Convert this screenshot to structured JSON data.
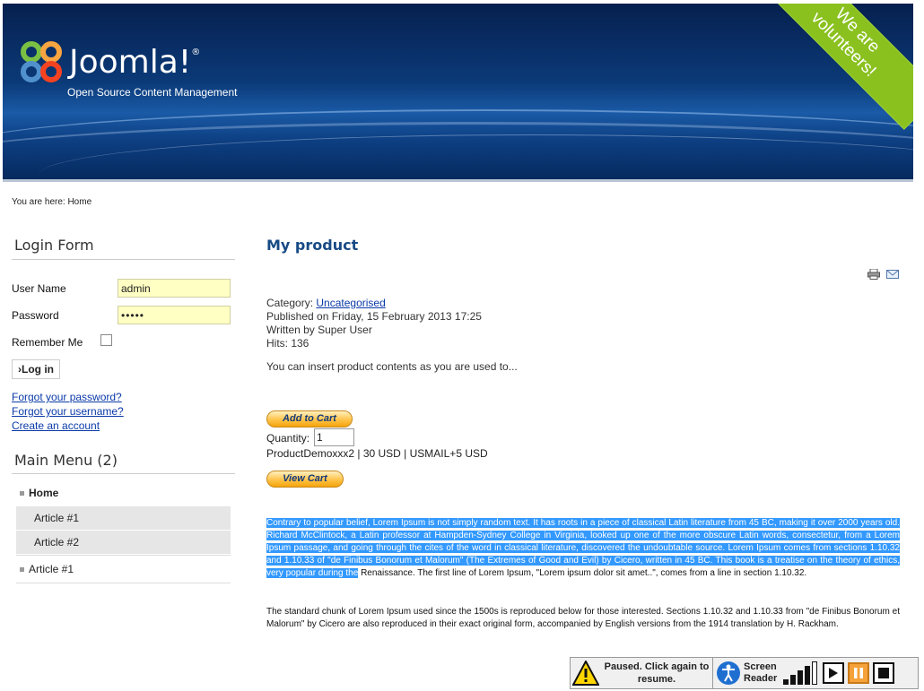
{
  "header": {
    "logo_text": "Joomla!",
    "tagline": "Open Source Content Management",
    "ribbon_line1": "We are",
    "ribbon_line2": "volunteers!"
  },
  "breadcrumb": "You are here: Home",
  "login": {
    "title": "Login Form",
    "username_label": "User Name",
    "username_value": "admin",
    "password_label": "Password",
    "password_value": "•••••",
    "remember_label": "Remember Me",
    "login_button": "›Log in",
    "links": [
      "Forgot your password?",
      "Forgot your username?",
      "Create an account"
    ]
  },
  "main_menu": {
    "title": "Main Menu (2)",
    "items": [
      {
        "label": "Home"
      },
      {
        "label": "Article #1"
      },
      {
        "label": "Article #2"
      },
      {
        "label": "Article #1"
      }
    ]
  },
  "content": {
    "title": "My product",
    "category_label": "Category:",
    "category_value": "Uncategorised",
    "published": "Published on Friday, 15 February 2013 17:25",
    "written_by": "Written by Super User",
    "hits": "Hits: 136",
    "intro": "You can insert product contents as you are used to...",
    "add_to_cart": "Add to Cart",
    "quantity_label": "Quantity:",
    "quantity_value": "1",
    "product_line": "ProductDemoxxx2 | 30 USD | USMAIL+5 USD",
    "view_cart": "View Cart",
    "para1_highlighted": "Contrary to popular belief, Lorem Ipsum is not simply random text. It has roots in a piece of classical Latin literature from 45 BC, making it over 2000 years old. Richard McClintock, a Latin professor at Hampden-Sydney College in Virginia, looked up one of the more obscure Latin words, consectetur, from a Lorem Ipsum passage, and going through the cites of the word in classical literature, discovered the undoubtable source. Lorem Ipsum comes from sections 1.10.32 and 1.10.33 of \"de Finibus Bonorum et Malorum\" (The Extremes of Good and Evil) by Cicero, written in 45 BC. This book is a treatise on the theory of ethics, very popular during the",
    "para1_rest": " Renaissance. The first line of Lorem Ipsum, \"Lorem ipsum dolor sit amet..\", comes from a line in section 1.10.32.",
    "para2": "The standard chunk of Lorem Ipsum used since the 1500s is reproduced below for those interested. Sections 1.10.32 and 1.10.33 from \"de Finibus Bonorum et Malorum\" by Cicero are also reproduced in their exact original form, accompanied by English versions from the 1914 translation by H. Rackham."
  },
  "screen_reader": {
    "paused_line1": "Paused. Click again to",
    "paused_line2": "resume.",
    "label_line1": "Screen",
    "label_line2": "Reader"
  },
  "colors": {
    "header_bg": "#0b3a78",
    "ribbon": "#8ac11f",
    "title_blue": "#174a85",
    "link_blue": "#0a3aa8",
    "input_yellow": "#ffffc4",
    "highlight": "#3399ff",
    "paypal_orange": "#ffc44a"
  }
}
